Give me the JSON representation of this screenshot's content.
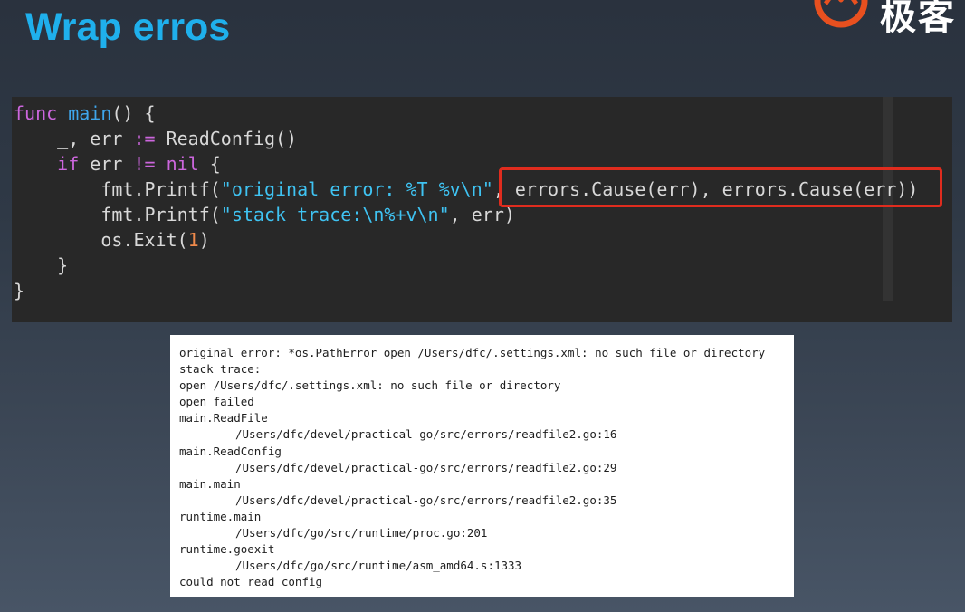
{
  "slide": {
    "title": "Wrap erros"
  },
  "logo": {
    "icon": "geektime-logo-icon",
    "text": "极客",
    "colors": {
      "accent": "#e8501f",
      "text": "#ffffff"
    }
  },
  "colors": {
    "title": "#1fb0ec",
    "keyword": "#cc66dd",
    "function": "#3fa6ec",
    "string": "#3fc3f2",
    "number": "#f08a4b",
    "highlight": "#e02c1e"
  },
  "code": {
    "line1": {
      "kw": "func",
      "sp": " ",
      "fn": "main",
      "rest": "() {"
    },
    "line2": {
      "indent": "    ",
      "a": "_, err ",
      "op": ":=",
      "b": " ReadConfig()"
    },
    "line3": {
      "indent": "    ",
      "kw": "if",
      "a": " err ",
      "op": "!=",
      "sp": " ",
      "nil": "nil",
      "b": " {"
    },
    "line4": {
      "indent": "        ",
      "a": "fmt.Printf(",
      "str": "\"original error: %T %v\\n\"",
      "b": ", errors.Cause(err), errors.Cause(err))"
    },
    "line5": {
      "indent": "        ",
      "a": "fmt.Printf(",
      "str": "\"stack trace:\\n%+v\\n\"",
      "b": ", err)"
    },
    "line6": {
      "indent": "        ",
      "a": "os.Exit(",
      "num": "1",
      "b": ")"
    },
    "line7": {
      "indent": "    ",
      "a": "}"
    },
    "line8": {
      "a": "}"
    }
  },
  "output": {
    "lines": [
      {
        "text": "original error: *os.PathError open /Users/dfc/.settings.xml: no such file or directory"
      },
      {
        "text": "stack trace:"
      },
      {
        "text": "open /Users/dfc/.settings.xml: no such file or directory"
      },
      {
        "text": "open failed"
      },
      {
        "text": "main.ReadFile"
      },
      {
        "text": "/Users/dfc/devel/practical-go/src/errors/readfile2.go:16"
      },
      {
        "text": "main.ReadConfig"
      },
      {
        "text": "/Users/dfc/devel/practical-go/src/errors/readfile2.go:29"
      },
      {
        "text": "main.main"
      },
      {
        "text": "/Users/dfc/devel/practical-go/src/errors/readfile2.go:35"
      },
      {
        "text": "runtime.main"
      },
      {
        "text": "/Users/dfc/go/src/runtime/proc.go:201"
      },
      {
        "text": "runtime.goexit"
      },
      {
        "text": "/Users/dfc/go/src/runtime/asm_amd64.s:1333"
      },
      {
        "text": "could not read config"
      }
    ]
  }
}
